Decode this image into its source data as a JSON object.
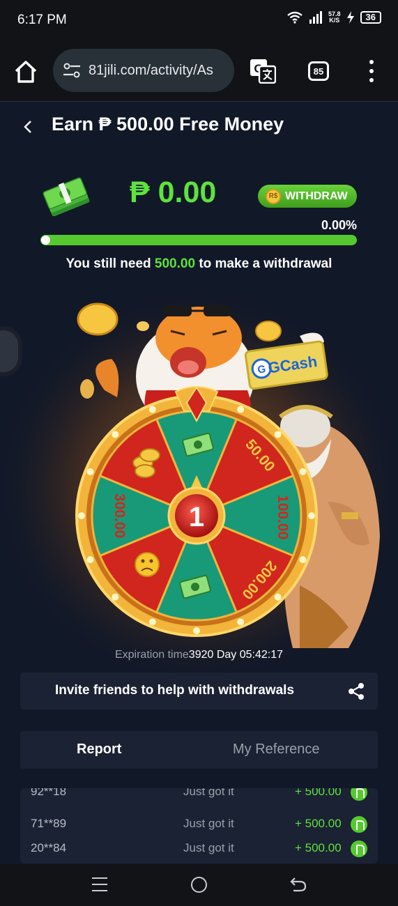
{
  "status_bar": {
    "time": "6:17 PM",
    "speed_value": "57.8",
    "speed_unit": "K/S",
    "battery": "36"
  },
  "browser": {
    "url": "81jili.com/activity/As",
    "tab_count": "85"
  },
  "header": {
    "title": "Earn ₱ 500.00 Free Money"
  },
  "balance": {
    "amount": "₱ 0.00",
    "withdraw_label": "WITHDRAW",
    "withdraw_coin": "R$",
    "percent_text": "0.00%",
    "progress": 0.0,
    "need_prefix": "You still need ",
    "need_amount": "500.00",
    "need_suffix": " to make a withdrawal"
  },
  "wheel": {
    "center_count": "1",
    "brand_label": "GCash",
    "segments": [
      "50.00",
      "100.00",
      "200.00",
      "300.00"
    ]
  },
  "expiration": {
    "label": "Expiration time",
    "value": "3920 Day 05:42:17"
  },
  "invite": {
    "label": "Invite friends to help with withdrawals"
  },
  "tabs": {
    "report": "Report",
    "reference": "My Reference"
  },
  "report_rows": [
    {
      "user": "92**18",
      "status": "Just got it",
      "amount": "+ 500.00"
    },
    {
      "user": "71**89",
      "status": "Just got it",
      "amount": "+ 500.00"
    },
    {
      "user": "20**84",
      "status": "Just got it",
      "amount": "+ 500.00"
    }
  ],
  "colors": {
    "background": "#111828",
    "accent_green": "#5de33d",
    "wheel_red": "#d0261e",
    "wheel_teal": "#189a78",
    "wheel_gold": "#f2b43a"
  }
}
